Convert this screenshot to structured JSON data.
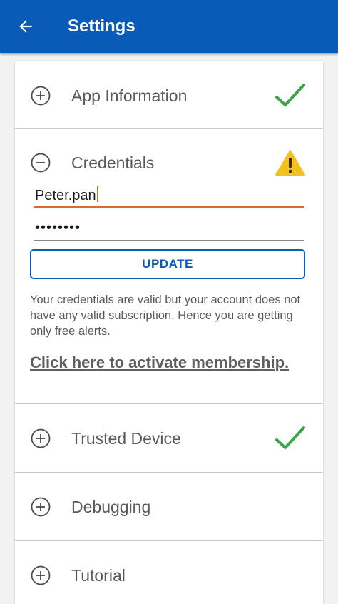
{
  "appbar": {
    "title": "Settings",
    "back_icon": "arrow-left-icon",
    "background": "#0a5bb8"
  },
  "sections": {
    "app_information": {
      "label": "App Information",
      "expanded": false,
      "status_icon": "check-icon"
    },
    "credentials": {
      "label": "Credentials",
      "expanded": true,
      "status_icon": "warning-icon",
      "username_value": "Peter.pan",
      "password_value": "••••••••",
      "update_label": "UPDATE",
      "info_text": "Your credentials are valid but your account does not have any valid subscription. Hence you are getting only free alerts.",
      "activate_link": "Click here to activate membership."
    },
    "trusted_device": {
      "label": "Trusted Device",
      "expanded": false,
      "status_icon": "check-icon"
    },
    "debugging": {
      "label": "Debugging",
      "expanded": false
    },
    "tutorial": {
      "label": "Tutorial",
      "expanded": false
    }
  },
  "colors": {
    "accent": "#0a5bb8",
    "success": "#3aa549",
    "warning": "#f4c020",
    "active_underline": "#d9692e"
  }
}
